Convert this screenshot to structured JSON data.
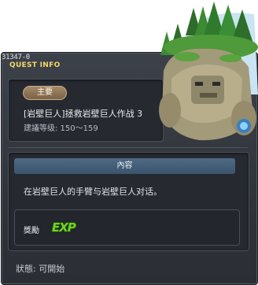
{
  "quest": {
    "id": "31347-0",
    "header": "QUEST INFO",
    "badge": "主要",
    "title": "[岩壁巨人]拯救岩壁巨人作战 3",
    "level": "建議等级: 150～159"
  },
  "content": {
    "header": "內容",
    "description": "在岩壁巨人的手臂与岩壁巨人对话。"
  },
  "reward": {
    "label": "獎勵",
    "exp_icon_text": "EXP"
  },
  "status": "狀態:  可開始",
  "icons": [
    "golem-npc-icon",
    "exp-icon"
  ],
  "colors": {
    "header_gold": "#f3d86a",
    "exp_green": "#6fd22a",
    "section_blue": "#4e6a85",
    "badge_brown": "#8f7555"
  }
}
